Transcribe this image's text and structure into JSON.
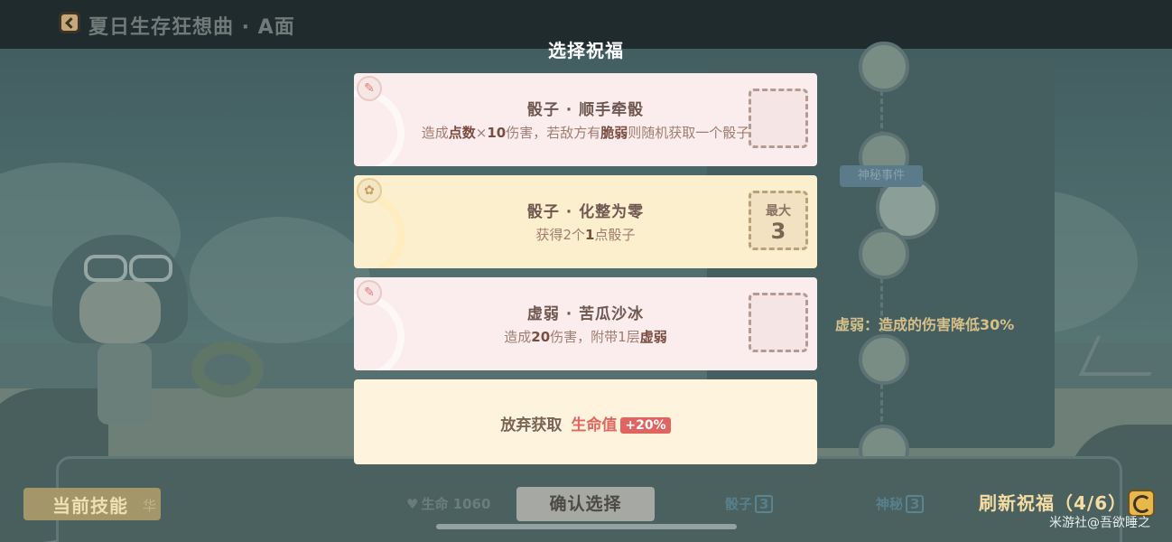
{
  "header": {
    "stage_title": "夏日生存狂想曲 · A面"
  },
  "modal": {
    "title": "选择祝福",
    "options": [
      {
        "name": "骰子 · 顺手牵骰",
        "description_parts": [
          "造成",
          "点数",
          "×",
          "10",
          "伤害，若敌方有",
          "脆弱",
          "则随机获取一个骰子"
        ],
        "theme": "pink",
        "icon": "claw-icon"
      },
      {
        "name": "骰子 · 化整为零",
        "description_parts": [
          "获得2个",
          "1",
          "点骰子"
        ],
        "theme": "yellow",
        "icon": "dice-split-icon",
        "slot_label": "最大",
        "slot_value": "3"
      },
      {
        "name": "虚弱 · 苦瓜沙冰",
        "description_parts": [
          "造成",
          "20",
          "伤害，附带1层",
          "虚弱"
        ],
        "theme": "pink",
        "icon": "claw-icon"
      }
    ],
    "abandon": {
      "label": "放弃获取",
      "stat": "生命值",
      "bonus": "+20%"
    }
  },
  "tooltip": {
    "text": "虚弱：造成的伤害降低30%"
  },
  "map": {
    "node_tag": "神秘事件"
  },
  "bottom_bar": {
    "skills_label": "当前技能",
    "skills_hint": "华",
    "hp_label": "生命 1060",
    "confirm_label": "确认选择",
    "dice_label": "骰子",
    "dice_count": "3",
    "relic_label": "神秘",
    "relic_count": "3",
    "refresh_label": "刷新祝福（4/6）"
  },
  "watermark": "米游社@吾欲睡之",
  "colors": {
    "accent_pink": "#fbedee",
    "accent_yellow": "#fcefcd",
    "hp_red": "#e2655f",
    "refresh_gold": "#f4dca3",
    "tooltip_gold": "#d6c089"
  }
}
